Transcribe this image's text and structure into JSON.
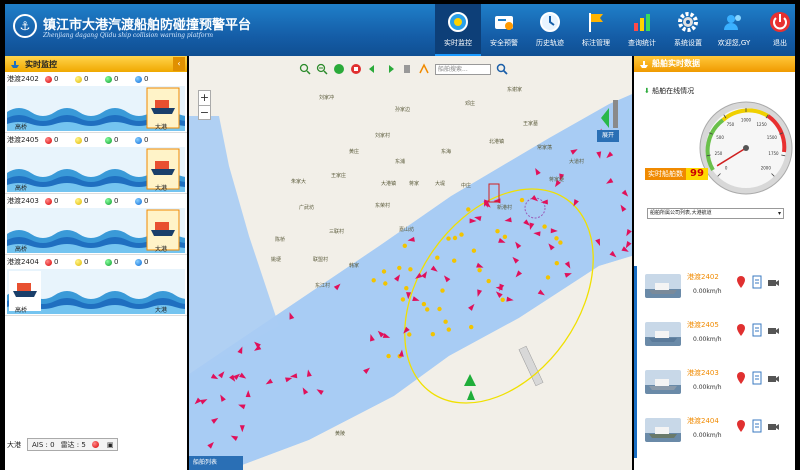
{
  "header": {
    "title": "镇江市大港汽渡船舶防碰撞预警平台",
    "subtitle": "Zhenjiang dagang Qiidu ship collision warning platform",
    "nav": [
      {
        "label": "实时监控",
        "icon": "monitor-icon",
        "active": true
      },
      {
        "label": "安全预警",
        "icon": "warning-icon",
        "active": false
      },
      {
        "label": "历史轨迹",
        "icon": "history-clock-icon",
        "active": false
      },
      {
        "label": "标注管理",
        "icon": "flag-icon",
        "active": false
      },
      {
        "label": "查询统计",
        "icon": "bar-chart-icon",
        "active": false
      },
      {
        "label": "系统设置",
        "icon": "gear-icon",
        "active": false
      },
      {
        "label": "欢迎您,GY",
        "icon": "user-icon",
        "active": false
      },
      {
        "label": "退出",
        "icon": "power-icon",
        "active": false
      }
    ]
  },
  "left_panel": {
    "title": "实时监控",
    "ferries": [
      {
        "name": "港渡2402",
        "red": "0",
        "yellow": "0",
        "green": "0",
        "blue": "0",
        "left_port": "高桥",
        "right_port": "大港",
        "ship_side": "right"
      },
      {
        "name": "港渡2405",
        "red": "0",
        "yellow": "0",
        "green": "0",
        "blue": "0",
        "left_port": "高桥",
        "right_port": "大港",
        "ship_side": "right"
      },
      {
        "name": "港渡2403",
        "red": "0",
        "yellow": "0",
        "green": "0",
        "blue": "0",
        "left_port": "高桥",
        "right_port": "大港",
        "ship_side": "right"
      },
      {
        "name": "港渡2404",
        "red": "0",
        "yellow": "0",
        "green": "0",
        "blue": "0",
        "left_port": "高桥",
        "right_port": "大港",
        "ship_side": "left"
      }
    ],
    "status": {
      "label": "大港",
      "ais": "AIS : 0",
      "radar": "雷达 : 5"
    }
  },
  "map": {
    "search_placeholder": "船舶搜索...",
    "zoom_in": "+",
    "zoom_out": "−",
    "expand_label": "展开",
    "bottom_tab": "船舶列表",
    "places": [
      "刘家冲",
      "东谢家",
      "孙家边",
      "邓庄",
      "王家墓",
      "常家荡",
      "刘家村",
      "东海",
      "东浦",
      "大堤",
      "黄庄",
      "朱家大",
      "王家庄",
      "大港镇",
      "中庄",
      "广武坊",
      "三联村",
      "东荣村",
      "嘉山坊",
      "陈桥",
      "韩家",
      "姚埂",
      "联盟村",
      "东江村",
      "蒋家",
      "新港村",
      "大道村",
      "北港镇",
      "蒋家埂",
      "黄陵"
    ]
  },
  "right_panel": {
    "title": "船舶实时数据",
    "online_label": "船舶在线情况",
    "count_label": "实时船舶数",
    "count_value": "99",
    "gauge_ticks": [
      "0",
      "250",
      "500",
      "750",
      "1000",
      "1250",
      "1500",
      "1750",
      "2000"
    ],
    "gauge_value": 99,
    "gauge_max": 2000,
    "route_select": "船舶所属公司列表,大港航道",
    "ships": [
      {
        "name": "港渡2402",
        "speed": "0.00km/h"
      },
      {
        "name": "港渡2405",
        "speed": "0.00km/h"
      },
      {
        "name": "港渡2403",
        "speed": "0.00km/h"
      },
      {
        "name": "港渡2404",
        "speed": "0.00km/h"
      }
    ]
  },
  "colors": {
    "header": "#155ea8",
    "accent_orange": "#f0a800",
    "river": "#a8ccf4",
    "alert_red": "#e0105a",
    "ship_yellow": "#f2c400"
  }
}
